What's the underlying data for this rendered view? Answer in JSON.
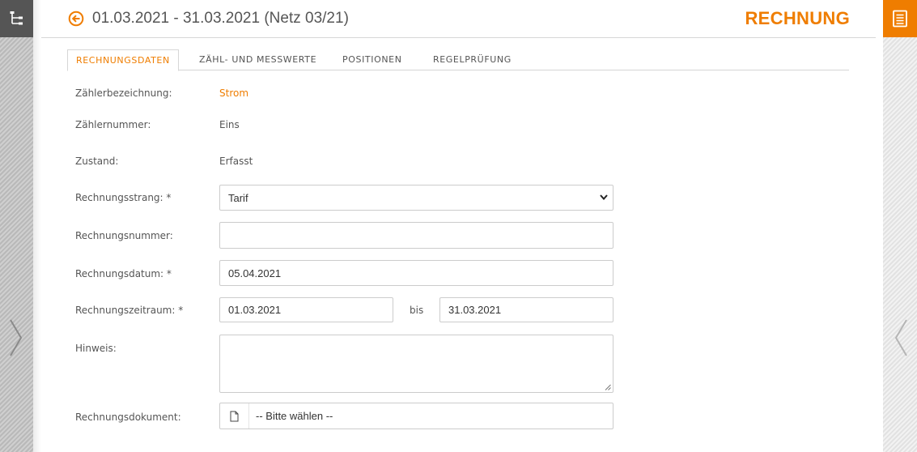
{
  "header": {
    "title": "01.03.2021 - 31.03.2021 (Netz 03/21)",
    "doc_type": "RECHNUNG",
    "accent_color": "#ef7d00"
  },
  "tabs": [
    {
      "label": "RECHNUNGSDATEN",
      "active": true
    },
    {
      "label": "ZÄHL- UND MESSWERTE",
      "active": false
    },
    {
      "label": "POSITIONEN",
      "active": false
    },
    {
      "label": "REGELPRÜFUNG",
      "active": false
    }
  ],
  "form": {
    "zaehlerbezeichnung": {
      "label": "Zählerbezeichnung:",
      "value": "Strom"
    },
    "zaehlernummer": {
      "label": "Zählernummer:",
      "value": "Eins"
    },
    "zustand": {
      "label": "Zustand:",
      "value": "Erfasst"
    },
    "rechnungsstrang": {
      "label": "Rechnungsstrang: *",
      "value": "Tarif"
    },
    "rechnungsnummer": {
      "label": "Rechnungsnummer:",
      "value": ""
    },
    "rechnungsdatum": {
      "label": "Rechnungsdatum: *",
      "value": "05.04.2021"
    },
    "rechnungszeitraum": {
      "label": "Rechnungszeitraum: *",
      "from": "01.03.2021",
      "separator": "bis",
      "to": "31.03.2021"
    },
    "hinweis": {
      "label": "Hinweis:",
      "value": ""
    },
    "rechnungsdokument": {
      "label": "Rechnungsdokument:",
      "value": "-- Bitte wählen --"
    }
  },
  "icons": {
    "left_top": "tree-structure-icon",
    "right_top": "document-list-icon",
    "back": "back-arrow-circle-icon",
    "left_nav": "chevron-right-icon",
    "right_nav": "chevron-left-icon",
    "file": "file-icon"
  }
}
